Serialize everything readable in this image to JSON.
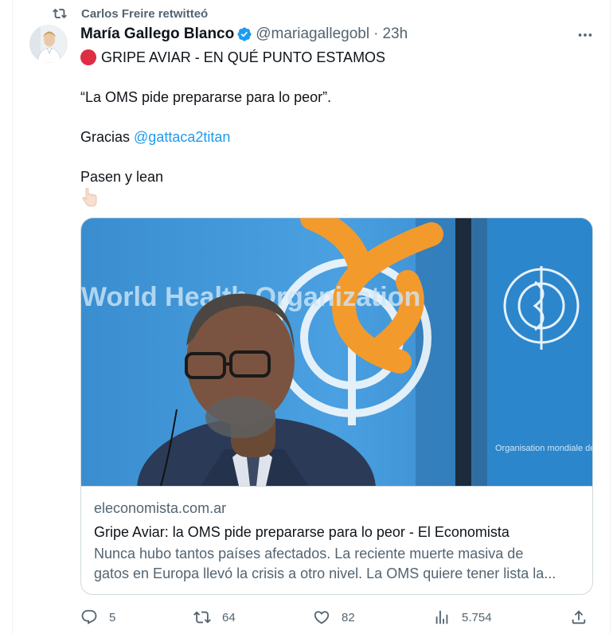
{
  "retweet": {
    "text": "Carlos Freire retwitteó",
    "icon": "retweet-icon"
  },
  "tweet": {
    "author_name": "María Gallego Blanco",
    "verified": true,
    "handle": "@mariagallegobl",
    "separator": "·",
    "time": "23h",
    "line1": "GRIPE AVIAR - EN QUÉ PUNTO ESTAMOS",
    "line2": "“La OMS pide prepararse para lo peor”.",
    "line3_prefix": "Gracias ",
    "mention": "@gattaca2titan",
    "line4": "Pasen y lean",
    "emoji_red_circle": "red-circle-emoji",
    "emoji_point_down": "point-down-emoji"
  },
  "card": {
    "image_text_left": "World Health Organization",
    "image_text_right": "Organisation mondiale de la Santé",
    "domain": "eleconomista.com.ar",
    "title": "Gripe Aviar: la OMS pide prepararse para lo peor - El Economista",
    "desc_line1": "Nunca hubo tantos países afectados. La reciente muerte masiva de",
    "desc_line2": "gatos en Europa llevó la crisis a otro nivel. La OMS quiere tener lista la..."
  },
  "actions": {
    "replies": "5",
    "retweets": "64",
    "likes": "82",
    "views": "5.754"
  },
  "colors": {
    "accent": "#1d9bf0",
    "secondary_text": "#536471",
    "who_blue": "#2b8fd6",
    "orange": "#f39a2d"
  }
}
